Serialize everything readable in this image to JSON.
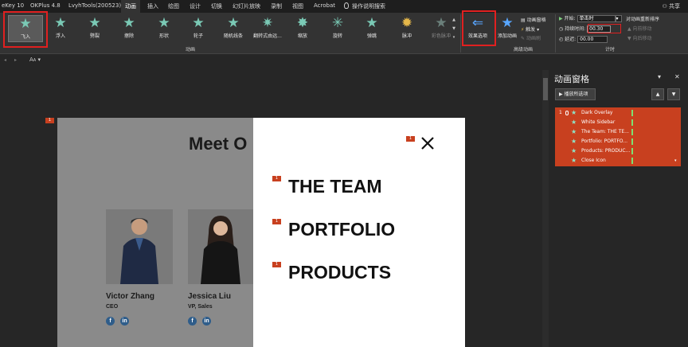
{
  "tabs": [
    {
      "label": "eKey 10"
    },
    {
      "label": "OKPlus 4.8"
    },
    {
      "label": "LvyhTools(200523)"
    },
    {
      "label": "动画"
    },
    {
      "label": "插入"
    },
    {
      "label": "绘图"
    },
    {
      "label": "设计"
    },
    {
      "label": "切换"
    },
    {
      "label": "幻灯片放映"
    },
    {
      "label": "录制"
    },
    {
      "label": "视图"
    },
    {
      "label": "Acrobat"
    }
  ],
  "search": {
    "label": "操作说明搜索"
  },
  "share": {
    "label": "共享"
  },
  "effects": [
    {
      "label": "飞入"
    },
    {
      "label": "浮入"
    },
    {
      "label": "劈裂"
    },
    {
      "label": "擦除"
    },
    {
      "label": "形状"
    },
    {
      "label": "轮子"
    },
    {
      "label": "随机线条"
    },
    {
      "label": "翻转式由远..."
    },
    {
      "label": "缩放"
    },
    {
      "label": "旋转"
    },
    {
      "label": "弹跳"
    },
    {
      "label": "脉冲"
    },
    {
      "label": "彩色脉冲"
    }
  ],
  "groups": {
    "animation": "动画",
    "advanced": "高级动画",
    "timing": "计时"
  },
  "effect_options": {
    "label": "效果选项"
  },
  "add_animation": {
    "label": "添加动画"
  },
  "animation_pane_btn": {
    "label": "动画窗格"
  },
  "trigger": {
    "label": "触发"
  },
  "painter": {
    "label": "动画刷"
  },
  "timing": {
    "start_label": "开始:",
    "start_value": "单击时",
    "duration_label": "持续时间:",
    "duration_value": "00.30",
    "delay_label": "延迟:",
    "delay_value": "00.00",
    "reorder_label": "对动画重新排序",
    "move_earlier": "向前移动",
    "move_later": "向后移动"
  },
  "slide": {
    "title": "Meet O",
    "menu": [
      "THE TEAM",
      "PORTFOLIO",
      "PRODUCTS"
    ],
    "people": [
      {
        "name": "Victor Zhang",
        "role": "CEO"
      },
      {
        "name": "Jessica Liu",
        "role": "VP, Sales"
      }
    ],
    "tag": "1",
    "social": {
      "facebook": "f",
      "linkedin": "in"
    }
  },
  "pane": {
    "title": "动画窗格",
    "play": "播放所选项",
    "items": [
      {
        "num": "1",
        "label": "Dark Overlay"
      },
      {
        "num": "",
        "label": "White Sidebar"
      },
      {
        "num": "",
        "label": "The Team: THE TE..."
      },
      {
        "num": "",
        "label": "Portfolio: PORTFO..."
      },
      {
        "num": "",
        "label": "Products: PRODUC..."
      },
      {
        "num": "",
        "label": "Close Icon"
      }
    ]
  }
}
